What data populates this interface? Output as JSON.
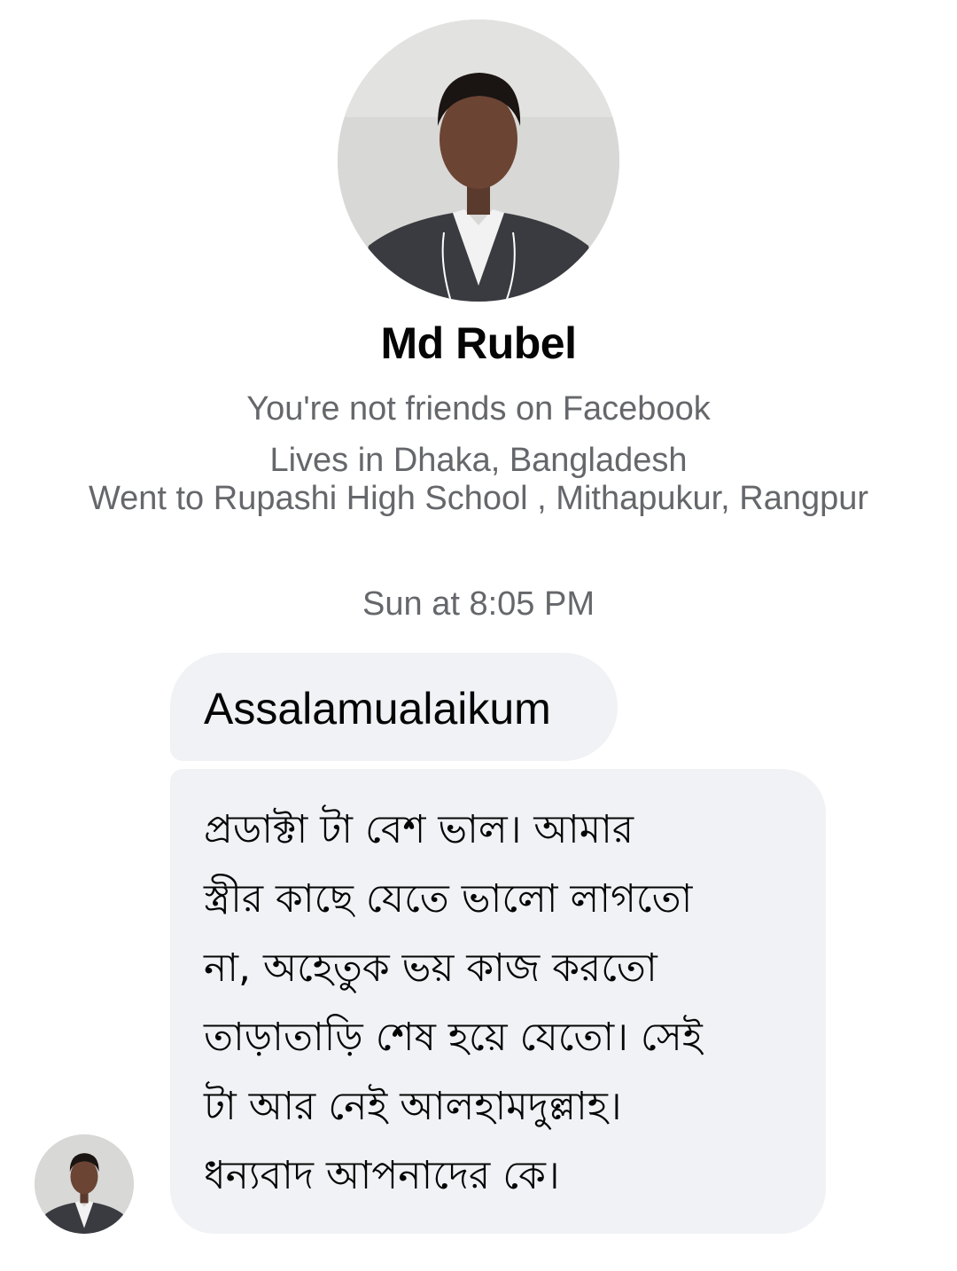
{
  "profile": {
    "name": "Md Rubel",
    "friend_status": "You're not friends on Facebook",
    "lives_in": "Lives in Dhaka, Bangladesh",
    "education": "Went to Rupashi High School , Mithapukur, Rangpur",
    "avatar_icon": "person-photo-icon"
  },
  "conversation": {
    "timestamp": "Sun at 8:05 PM",
    "messages": [
      {
        "sender": "Md Rubel",
        "text": "Assalamualaikum"
      },
      {
        "sender": "Md Rubel",
        "text": "প্রডাক্টা টা বেশ ভাল। আমার\nস্ত্রীর কাছে যেতে ভালো লাগতো\nনা, অহেতুক ভয় কাজ করতো\nতাড়াতাড়ি শেষ হয়ে যেতো। সেই\nটা আর নেই আলহামদুল্লাহ।\nধন্যবাদ আপনাদের কে।"
      }
    ]
  },
  "colors": {
    "bubble_background": "#f0f2f5",
    "secondary_text": "#65676b",
    "primary_text": "#050505"
  }
}
